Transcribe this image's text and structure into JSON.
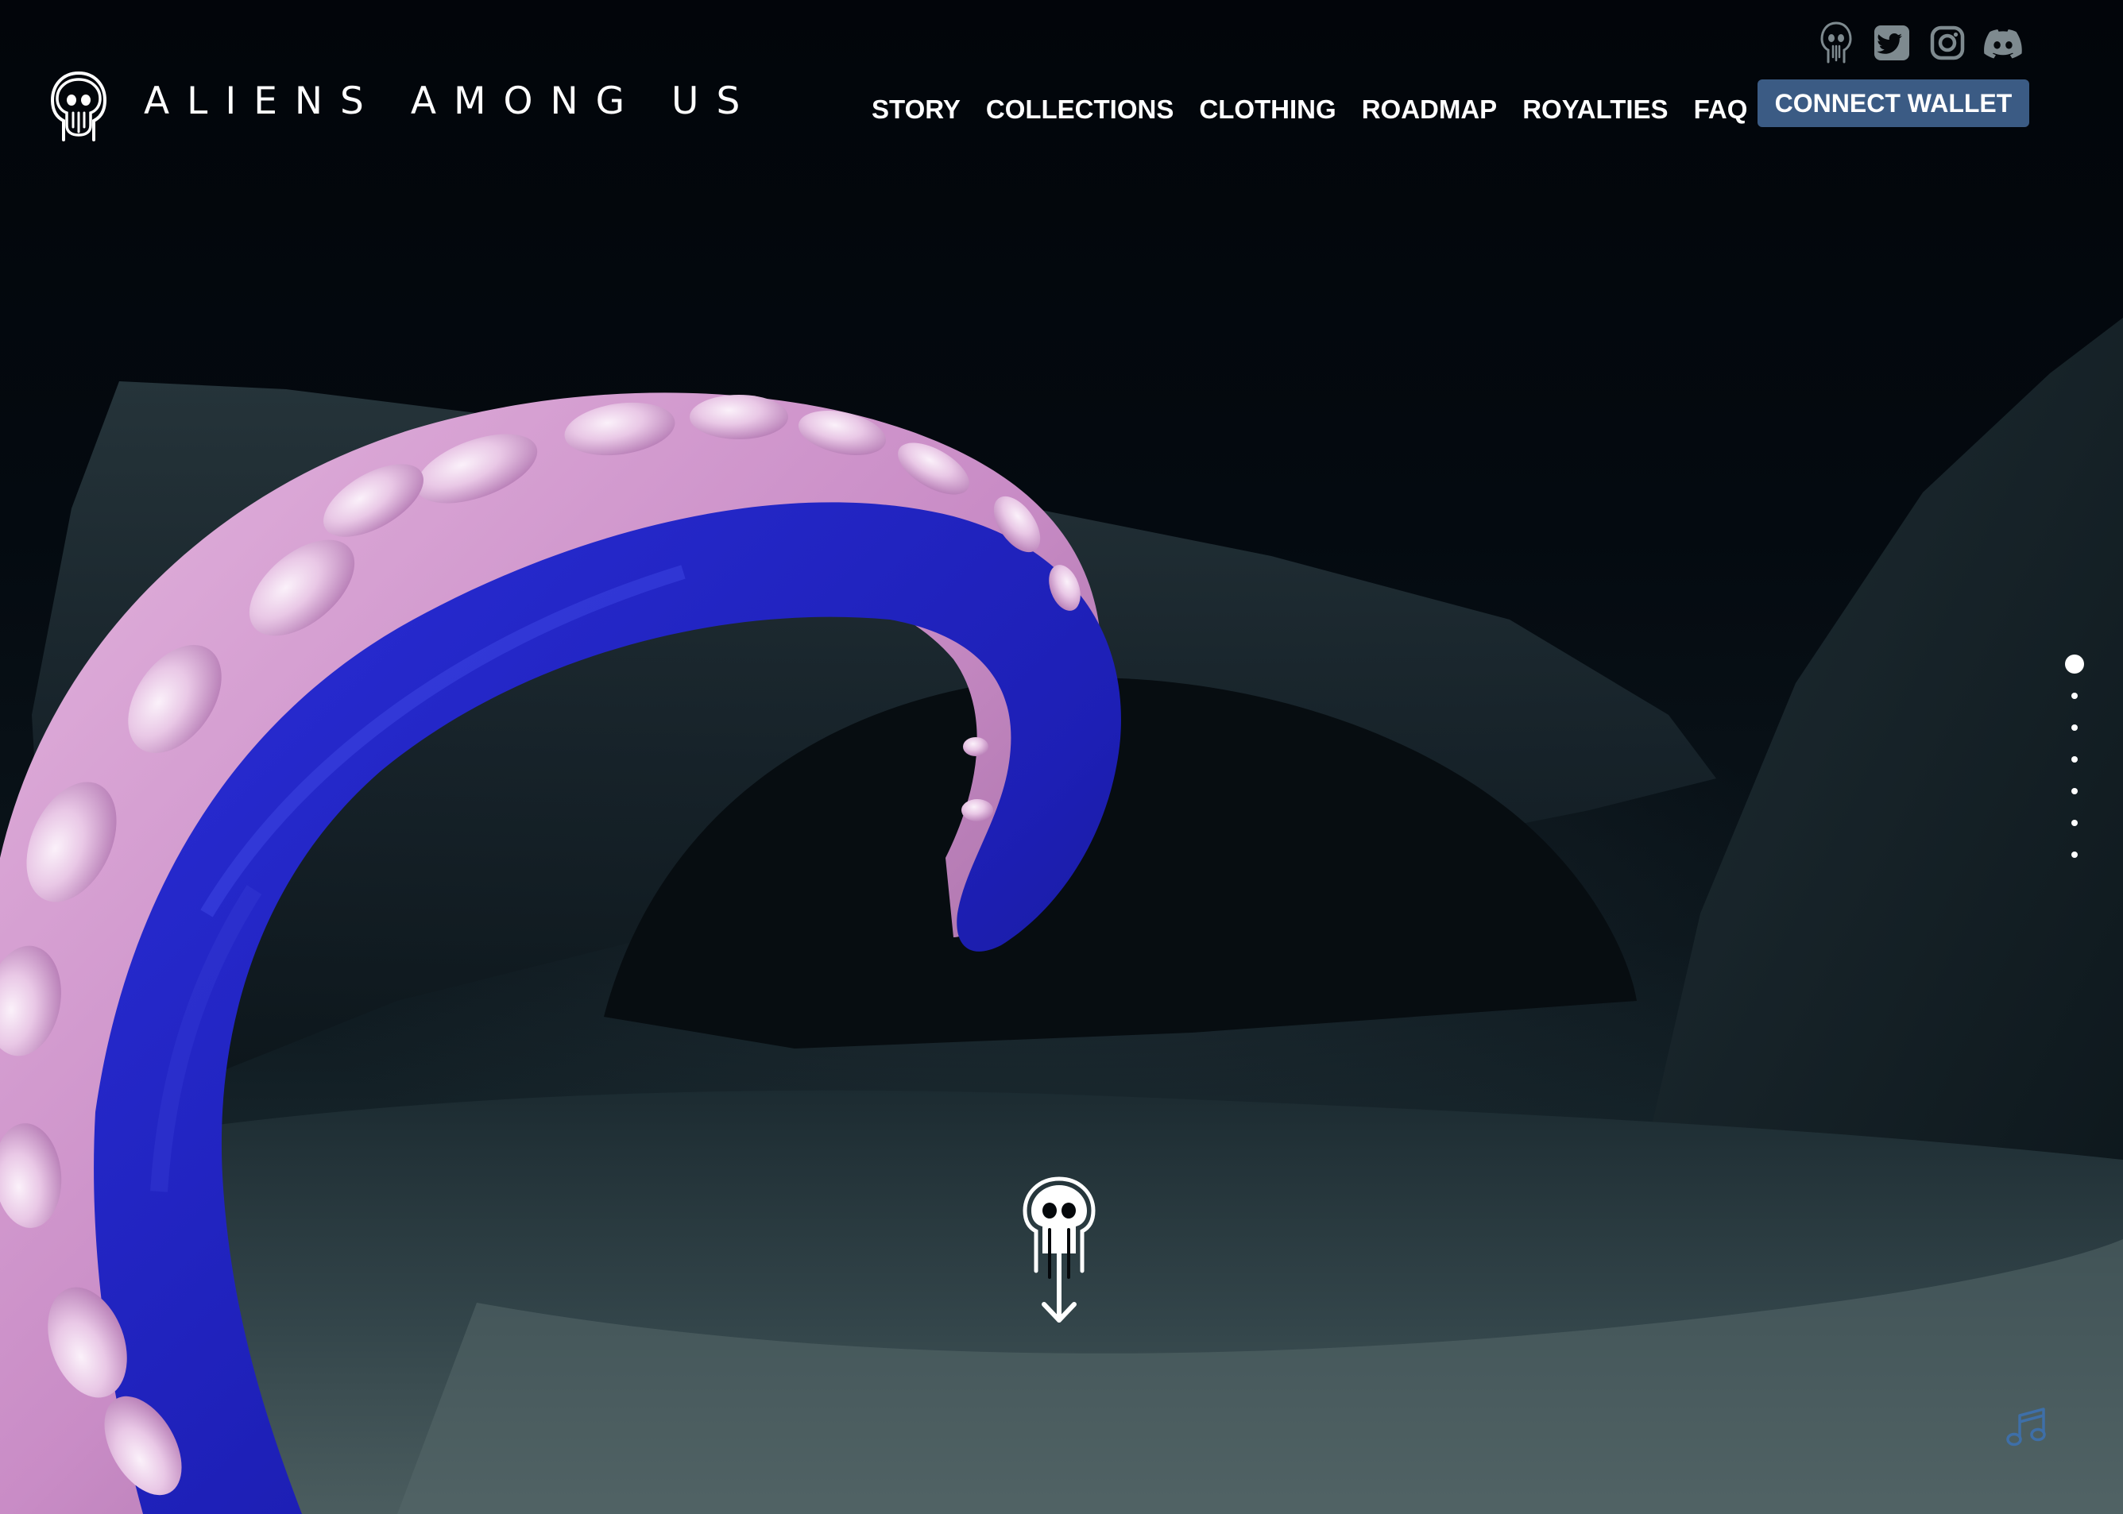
{
  "header": {
    "site_title": "ALIENS AMONG US",
    "logo_icon": "alien-jellyfish-logo-icon"
  },
  "nav": {
    "items": [
      {
        "label": "STORY"
      },
      {
        "label": "COLLECTIONS"
      },
      {
        "label": "CLOTHING"
      },
      {
        "label": "ROADMAP"
      },
      {
        "label": "ROYALTIES"
      },
      {
        "label": "FAQ"
      }
    ]
  },
  "wallet": {
    "connect_label": "CONNECT WALLET",
    "button_color": "#3b5b84"
  },
  "socials": [
    {
      "icon": "alien-jellyfish-icon"
    },
    {
      "icon": "twitter-icon"
    },
    {
      "icon": "instagram-icon"
    },
    {
      "icon": "discord-icon"
    }
  ],
  "pager": {
    "count": 7,
    "active_index": 0
  },
  "scroll_indicator": {
    "icon": "alien-scroll-down-icon"
  },
  "music": {
    "icon": "music-note-icon",
    "color": "#3e6fa8"
  },
  "colors": {
    "tentacle_sucker": "#d9a4d4",
    "tentacle_inner": "#2020c0",
    "background": "#05080b"
  }
}
